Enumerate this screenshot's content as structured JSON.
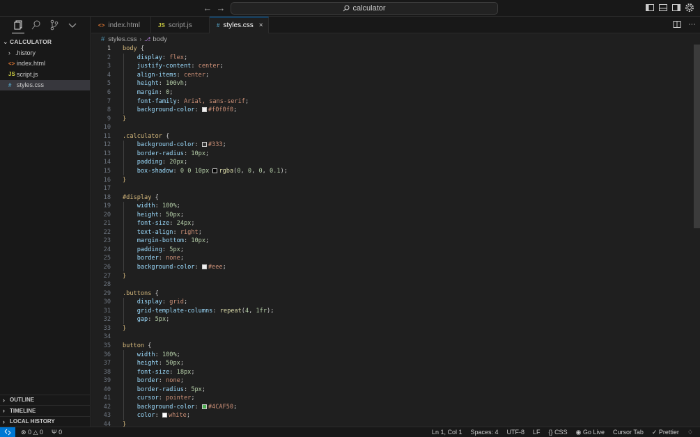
{
  "titlebar": {
    "search_text": "calculator",
    "icons": [
      "arrow-left-icon",
      "arrow-right-icon",
      "search-icon",
      "toggle-primary-sidebar-icon",
      "toggle-panel-icon",
      "toggle-secondary-sidebar-icon",
      "gear-icon"
    ]
  },
  "sidebar": {
    "folder_name": "CALCULATOR",
    "items": [
      {
        "label": ".history",
        "type": "folder"
      },
      {
        "label": "index.html",
        "type": "html"
      },
      {
        "label": "script.js",
        "type": "js"
      },
      {
        "label": "styles.css",
        "type": "css",
        "selected": true
      }
    ],
    "sections": [
      "OUTLINE",
      "TIMELINE",
      "LOCAL HISTORY"
    ]
  },
  "tabs": [
    {
      "label": "index.html",
      "icon": "<>"
    },
    {
      "label": "script.js",
      "icon": "JS"
    },
    {
      "label": "styles.css",
      "icon": "#",
      "active": true
    }
  ],
  "breadcrumb": {
    "file": "styles.css",
    "symbol": "body"
  },
  "code": [
    "body {",
    "    display: flex;",
    "    justify-content: center;",
    "    align-items: center;",
    "    height: 100vh;",
    "    margin: 0;",
    "    font-family: Arial, sans-serif;",
    "    background-color: #f0f0f0;",
    "}",
    "",
    ".calculator {",
    "    background-color: #333;",
    "    border-radius: 10px;",
    "    padding: 20px;",
    "    box-shadow: 0 0 10px rgba(0, 0, 0, 0.1);",
    "}",
    "",
    "#display {",
    "    width: 100%;",
    "    height: 50px;",
    "    font-size: 24px;",
    "    text-align: right;",
    "    margin-bottom: 10px;",
    "    padding: 5px;",
    "    border: none;",
    "    background-color: #eee;",
    "}",
    "",
    ".buttons {",
    "    display: grid;",
    "    grid-template-columns: repeat(4, 1fr);",
    "    gap: 5px;",
    "}",
    "",
    "button {",
    "    width: 100%;",
    "    height: 50px;",
    "    font-size: 18px;",
    "    border: none;",
    "    border-radius: 5px;",
    "    cursor: pointer;",
    "    background-color: #4CAF50;",
    "    color: white;",
    "}"
  ],
  "line_numbers": [
    "1",
    "2",
    "3",
    "4",
    "5",
    "6",
    "7",
    "8",
    "9",
    "10",
    "11",
    "12",
    "13",
    "14",
    "15",
    "16",
    "17",
    "18",
    "19",
    "20",
    "21",
    "22",
    "23",
    "24",
    "25",
    "26",
    "27",
    "28",
    "29",
    "30",
    "31",
    "32",
    "33",
    "34",
    "35",
    "36",
    "37",
    "38",
    "39",
    "40",
    "41",
    "42",
    "43",
    "44"
  ],
  "swatch_colors": {
    "8": "#f0f0f0",
    "12": "#333333",
    "15": "#000000",
    "26": "#eeeeee",
    "42": "#4CAF50",
    "43": "#ffffff"
  },
  "statusbar": {
    "errors": "0",
    "warnings": "0",
    "ports": "0",
    "position": "Ln 1, Col 1",
    "spaces": "Spaces: 4",
    "encoding": "UTF-8",
    "eol": "LF",
    "language": "CSS",
    "go_live": "Go Live",
    "cursor_tab": "Cursor Tab",
    "prettier": "Prettier"
  },
  "colors": {
    "accent": "#0078d4",
    "editor_bg": "#1f1f1f",
    "sidebar_bg": "#181818"
  }
}
